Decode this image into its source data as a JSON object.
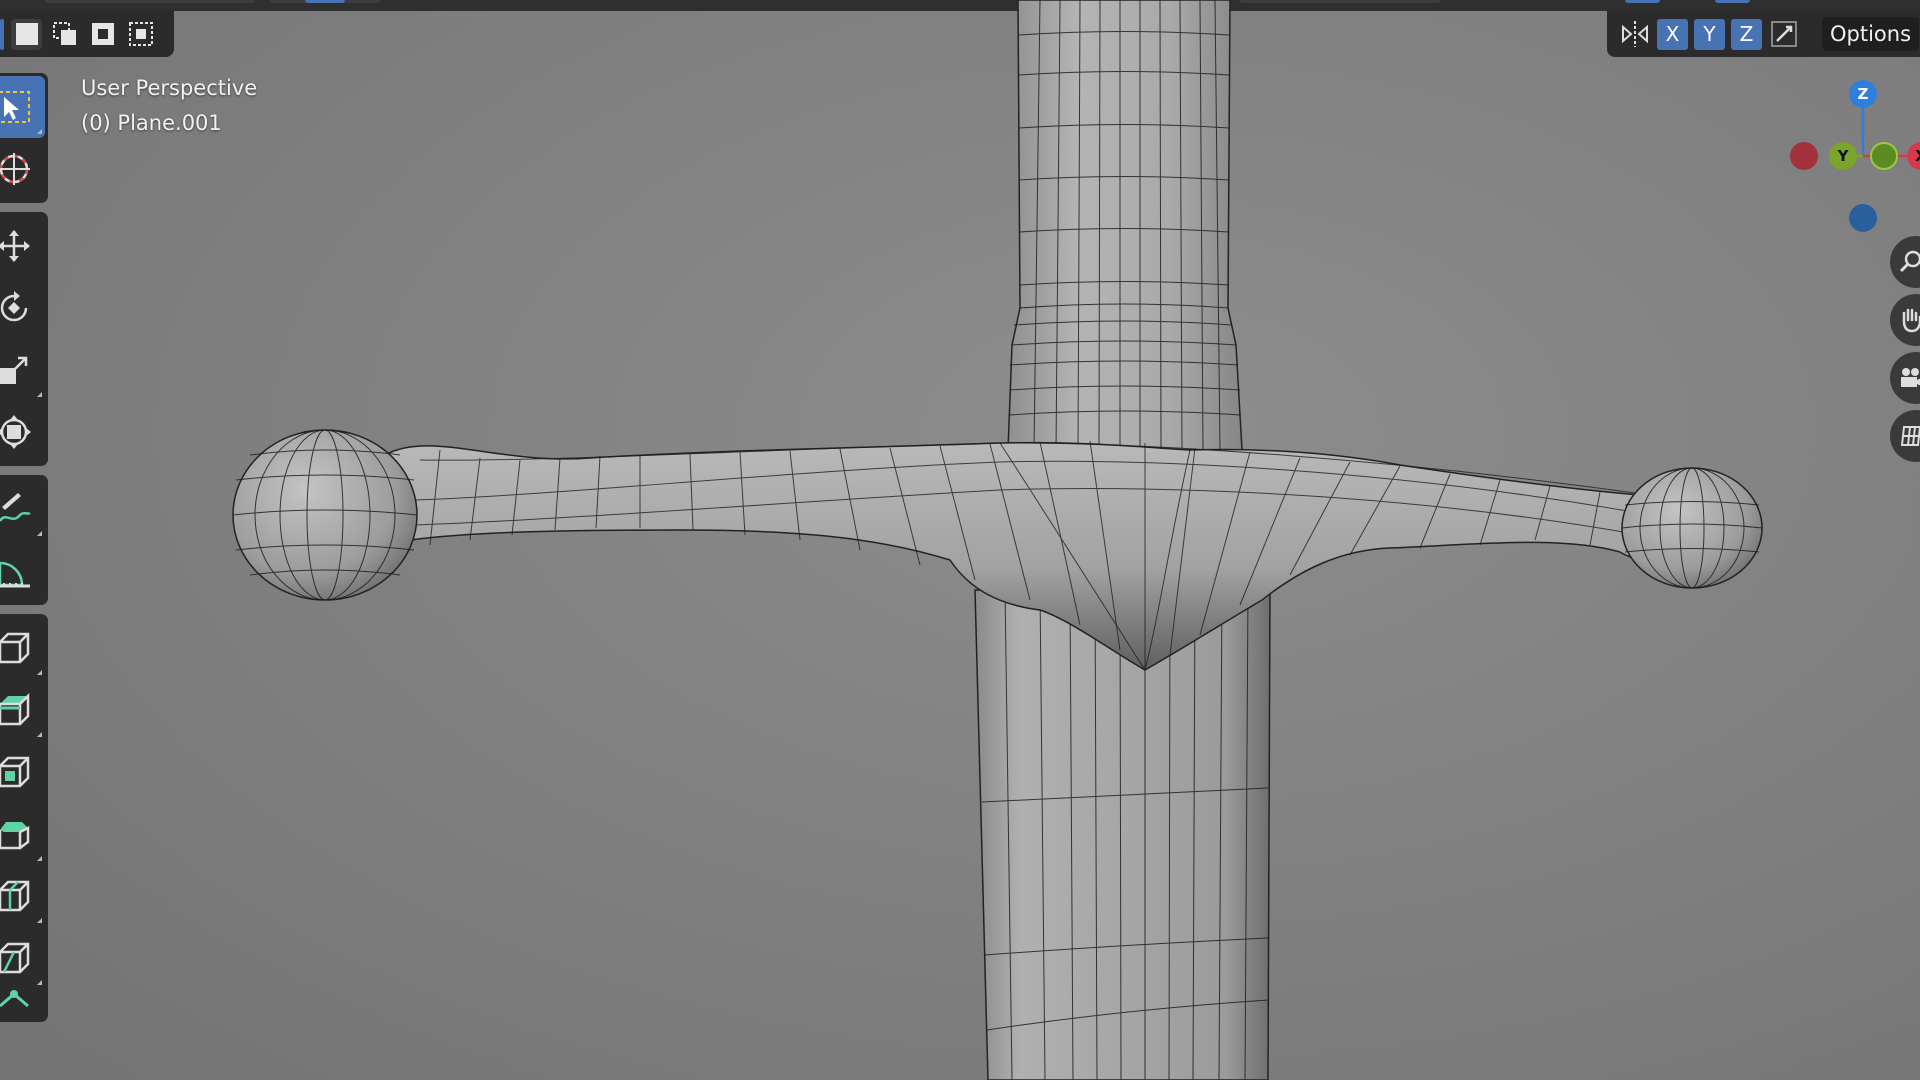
{
  "viewport": {
    "view_name": "User Perspective",
    "object_label": "(0) Plane.001",
    "background_color": "#7f7f7f"
  },
  "header": {
    "axis_buttons": [
      "X",
      "Y",
      "Z"
    ],
    "options_label": "Options",
    "accent_color": "#4772b3"
  },
  "gizmo": {
    "z_label": "Z",
    "y_label": "Y",
    "x_label": "X",
    "colors": {
      "x": "#d63a4a",
      "y": "#7aa52b",
      "z": "#2f7fdc"
    }
  },
  "selection_modes": [
    "select-new-icon",
    "select-extend-icon",
    "select-subtract-icon",
    "select-intersect-icon"
  ],
  "tools": [
    "select-box-icon",
    "cursor-icon",
    "move-icon",
    "rotate-icon",
    "scale-icon",
    "transform-icon",
    "annotate-icon",
    "measure-icon",
    "add-cube-icon",
    "extrude-region-icon",
    "inset-faces-icon",
    "bevel-icon",
    "loop-cut-icon",
    "knife-icon",
    "poly-build-icon"
  ],
  "nav_icons": [
    "zoom-icon",
    "pan-hand-icon",
    "camera-icon",
    "grid-view-icon"
  ]
}
